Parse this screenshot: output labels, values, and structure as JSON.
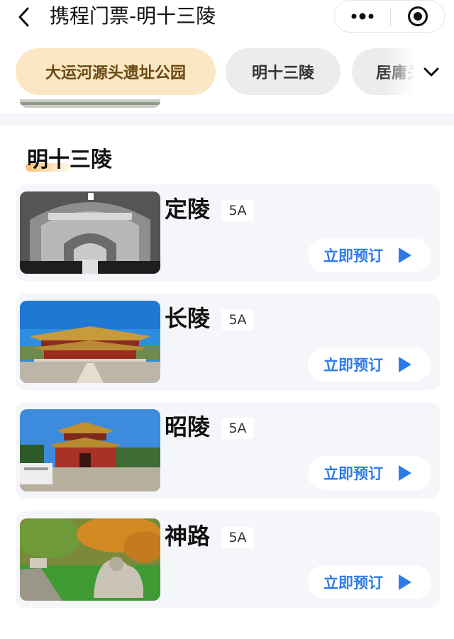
{
  "header": {
    "title": "携程门票-明十三陵",
    "back_icon": "chevron-left-icon",
    "more_icon": "more-dots-icon",
    "close_icon": "target-circle-icon"
  },
  "tabs": [
    {
      "label": "大运河源头遗址公园",
      "active": true
    },
    {
      "label": "明十三陵",
      "active": false
    },
    {
      "label": "居庸关",
      "active": false
    }
  ],
  "tabs_expand_icon": "chevron-down-icon",
  "section": {
    "title": "明十三陵"
  },
  "attractions": [
    {
      "name": "定陵",
      "level": "5A",
      "book_label": "立即预订",
      "image": "tunnel-arch-photo"
    },
    {
      "name": "长陵",
      "level": "5A",
      "book_label": "立即预订",
      "image": "palace-hall-photo"
    },
    {
      "name": "昭陵",
      "level": "5A",
      "book_label": "立即预订",
      "image": "red-tower-photo"
    },
    {
      "name": "神路",
      "level": "5A",
      "book_label": "立即预订",
      "image": "stone-lion-photo"
    }
  ],
  "colors": {
    "accent_blue": "#2e7be8",
    "active_tab_bg": "#fbe7c4",
    "active_tab_text": "#6b4a12",
    "card_bg": "#f5f6fa"
  }
}
